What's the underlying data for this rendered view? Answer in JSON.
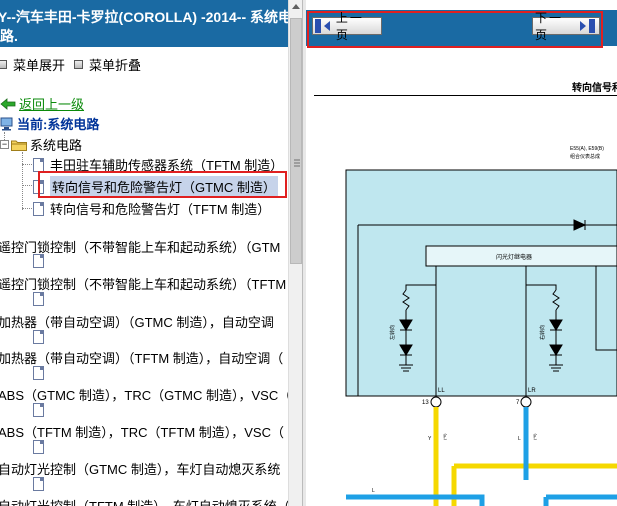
{
  "left_header": {
    "line1": "Y--汽车丰田-卡罗拉(COROLLA) -2014-- 系统电",
    "line2": "路."
  },
  "menu": {
    "expand_label": "菜单展开",
    "collapse_label": "菜单折叠"
  },
  "back_label": "返回上一级",
  "current_label": "当前:系统电路",
  "folder_label": "系统电路",
  "tree_items": [
    {
      "label": "丰田驻车辅助传感器系统（TFTM 制造）"
    },
    {
      "label": "转向信号和危险警告灯（GTMC 制造）",
      "selected": true
    },
    {
      "label": "转向信号和危险警告灯（TFTM 制造）"
    }
  ],
  "long_items": [
    {
      "label": "遥控门锁控制（不带智能上车和起动系统）（GTM"
    },
    {
      "label": "遥控门锁控制（不带智能上车和起动系统）（TFTM"
    },
    {
      "label": "加热器（带自动空调）（GTMC 制造），自动空调"
    },
    {
      "label": "加热器（带自动空调）（TFTM 制造），自动空调（"
    },
    {
      "label": "ABS（GTMC 制造），TRC（GTMC 制造），VSC（"
    },
    {
      "label": "ABS（TFTM 制造），TRC（TFTM 制造），VSC（"
    },
    {
      "label": "自动灯光控制（GTMC 制造），车灯自动熄灭系统（"
    },
    {
      "label": "自动灯光控制（TFTM 制造），车灯自动熄灭系统（"
    }
  ],
  "nav": {
    "prev_label": "上一页",
    "next_label": "下一页"
  },
  "diagram": {
    "title": "转向信号和",
    "module_label1": "E55(A), E59(B)",
    "module_label2": "组合仪表总成",
    "relay_label": "闪光灯继电器",
    "left_lamp_label": "左转向",
    "right_lamp_label": "右转向",
    "pin_left_name": "LL",
    "pin_right_name": "LR",
    "pin_left_num": "13",
    "pin_right_num": "7",
    "wire_left_color": "Y",
    "wire_right_color": "L",
    "wire_tag": "(*6)",
    "bottom_wire_label": "L"
  },
  "colors": {
    "header_bg": "#1a6aa3",
    "highlight_border": "#e02020",
    "module_fill": "#bfe7ef",
    "wire_yellow": "#f5d800",
    "wire_blue": "#1ea0e6"
  }
}
